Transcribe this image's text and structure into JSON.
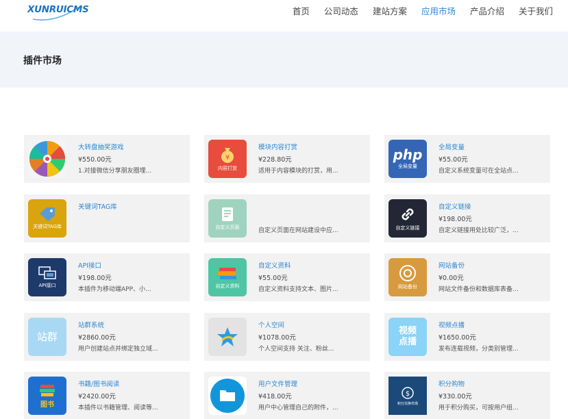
{
  "logo": {
    "text": "XUNRUICMS"
  },
  "nav": {
    "items": [
      "首页",
      "公司动态",
      "建站方案",
      "应用市场",
      "产品介绍",
      "关于我们"
    ],
    "active_index": 3
  },
  "banner": {
    "title": "插件市场"
  },
  "plugins": [
    {
      "name": "大转盘抽奖游戏",
      "price": "¥550.00元",
      "desc": "1.对接微信分享朋友圈埋...",
      "icon": "wheel-icon",
      "icon_label": ""
    },
    {
      "name": "模块内容打赏",
      "price": "¥228.80元",
      "desc": "适用于内容模块的打赏，用...",
      "icon": "money-bag-icon",
      "icon_label": "内容打赏"
    },
    {
      "name": "全局变量",
      "price": "¥55.00元",
      "desc": "自定义系统变量可在全站点...",
      "icon": "php-icon",
      "icon_label": "全局变量"
    },
    {
      "name": "关键词TAG库",
      "price": "",
      "desc": "",
      "icon": "tag-icon",
      "icon_label": "关键词TAG库"
    },
    {
      "name": "",
      "price": "",
      "desc": "自定义页面在网站建设中应...",
      "icon": "page-icon",
      "icon_label": "自定义页面"
    },
    {
      "name": "自定义链接",
      "price": "¥198.00元",
      "desc": "自定义链接用处比较广泛，...",
      "icon": "link-icon",
      "icon_label": "自定义链接"
    },
    {
      "name": "API接口",
      "price": "¥198.00元",
      "desc": "本插件为移动端APP、小...",
      "icon": "api-icon",
      "icon_label": "API接口"
    },
    {
      "name": "自定义资料",
      "price": "¥55.00元",
      "desc": "自定义资料支持文本、图片...",
      "icon": "books-icon",
      "icon_label": "自定义资料"
    },
    {
      "name": "网站备份",
      "price": "¥0.00元",
      "desc": "网站文件备份和数据库表备...",
      "icon": "backup-icon",
      "icon_label": "网站备份"
    },
    {
      "name": "站群系统",
      "price": "¥2860.00元",
      "desc": "用户创建站点并绑定独立域...",
      "icon": "site-group-icon",
      "icon_label": "站群"
    },
    {
      "name": "个人空间",
      "price": "¥1078.00元",
      "desc": "个人空间支持 关注、粉丝...",
      "icon": "star-icon",
      "icon_label": ""
    },
    {
      "name": "视频点播",
      "price": "¥1650.00元",
      "desc": "发布连载视频，分类别管理...",
      "icon": "video-icon",
      "icon_label": "视频点播"
    },
    {
      "name": "书籍/图书阅读",
      "price": "¥2420.00元",
      "desc": "本插件以书籍管理、阅读等...",
      "icon": "book-stack-icon",
      "icon_label": "图书"
    },
    {
      "name": "用户文件管理",
      "price": "¥418.00元",
      "desc": "用户中心管理自己的附件，...",
      "icon": "folder-icon",
      "icon_label": ""
    },
    {
      "name": "积分购物",
      "price": "¥330.00元",
      "desc": "用于积分购买，可按用户组...",
      "icon": "points-icon",
      "icon_label": "积分兑换市场"
    }
  ]
}
